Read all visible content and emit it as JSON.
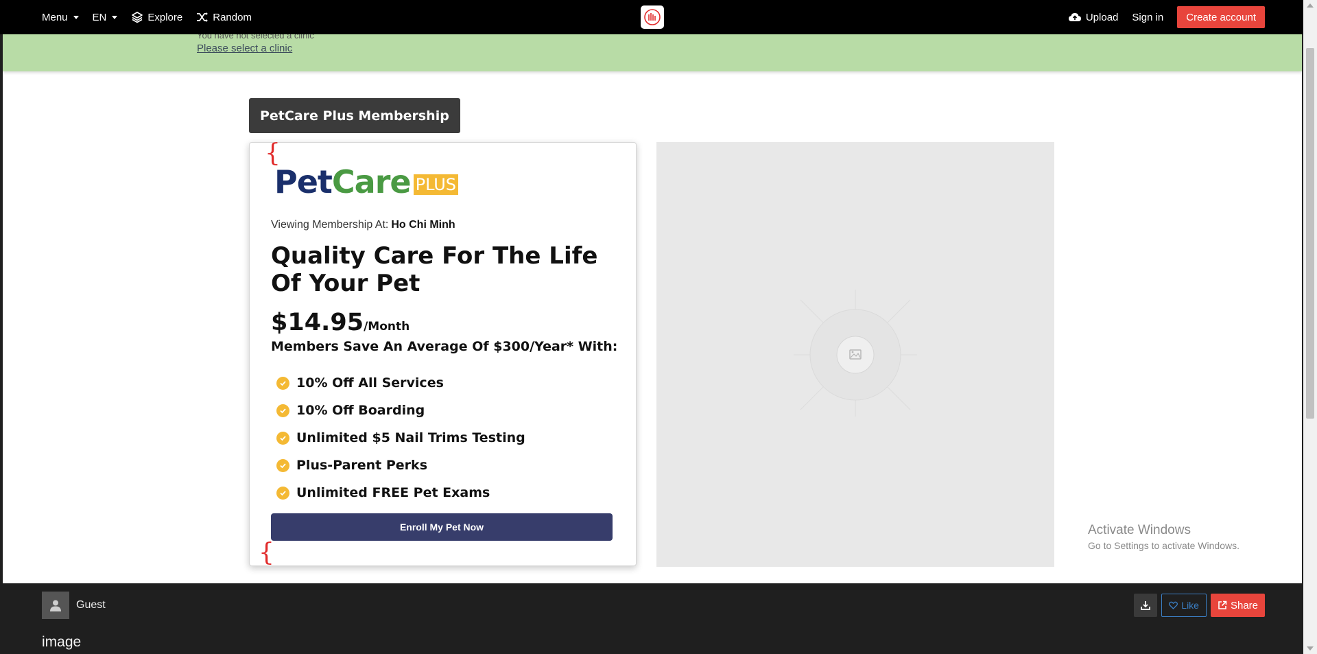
{
  "nav": {
    "menu": "Menu",
    "language": "EN",
    "explore": "Explore",
    "random": "Random",
    "upload": "Upload",
    "sign_in": "Sign in",
    "create_account": "Create account"
  },
  "banner": {
    "line1": "You have not selected a clinic",
    "link": "Please select a clinic"
  },
  "page": {
    "title": "PetCare Plus Membership"
  },
  "card": {
    "brand_pet": "Pet",
    "brand_care": "Care",
    "brand_plus": "PLUS",
    "viewing_label": "Viewing Membership At:",
    "viewing_city": "Ho Chi Minh",
    "headline": "Quality Care For The Life Of Your Pet",
    "price": "$14.95",
    "per": "/Month",
    "savings": "Members Save An Average Of $300/Year* With:",
    "benefits": [
      "10% Off All Services",
      "10% Off Boarding",
      "Unlimited $5 Nail Trims Testing",
      "Plus-Parent Perks",
      "Unlimited FREE Pet Exams"
    ],
    "enroll": "Enroll My Pet Now"
  },
  "watermark": {
    "title": "Activate Windows",
    "subtitle": "Go to Settings to activate Windows."
  },
  "footer": {
    "user": "Guest",
    "label": "image",
    "like": "Like",
    "share": "Share"
  },
  "colors": {
    "accent_red": "#e8453c",
    "banner_green": "#b8dca6",
    "enroll_navy": "#373d6b",
    "check_yellow": "#f4b934",
    "brand_navy": "#1a2f6b",
    "brand_green": "#4a9a43"
  }
}
